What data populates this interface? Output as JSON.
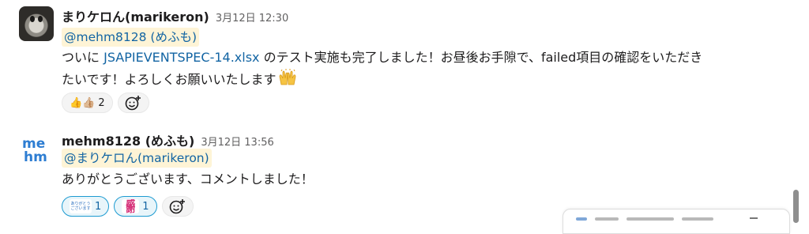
{
  "messages": [
    {
      "sender": "まりケロん(marikeron)",
      "time": "3月12日 12:30",
      "mention": "@mehm8128 (めふも)",
      "line1_pre": "ついに ",
      "line1_link": "JSAPIEVENTSPEC-14.xlsx",
      "line1_post": " のテスト実施も完了しました！お昼後お手隙で、failed項目の確認をいただき",
      "line2": "たいです！よろしくお願いいたします",
      "reactions": [
        {
          "emoji": "👍👍🏼",
          "count": "2"
        }
      ],
      "add_reaction_icon": "add-reaction-icon"
    },
    {
      "sender": "mehm8128 (めふも)",
      "time": "3月12日 13:56",
      "mention": "@まりケロん(marikeron)",
      "line1": "ありがとうございます、コメントしました！",
      "reactions": [
        {
          "emoji_text": "ありがとう ございます",
          "count": "1"
        },
        {
          "emoji_text": "感謝",
          "count": "1"
        }
      ],
      "add_reaction_icon": "add-reaction-icon"
    }
  ],
  "colors": {
    "link": "#1264a3",
    "mention_bg_yellow": "#fef4d6",
    "mention_bg_blue": "#e8f5fa",
    "reaction_active_border": "#1d9bd1",
    "text": "#1d1c1d",
    "muted": "#616061"
  }
}
